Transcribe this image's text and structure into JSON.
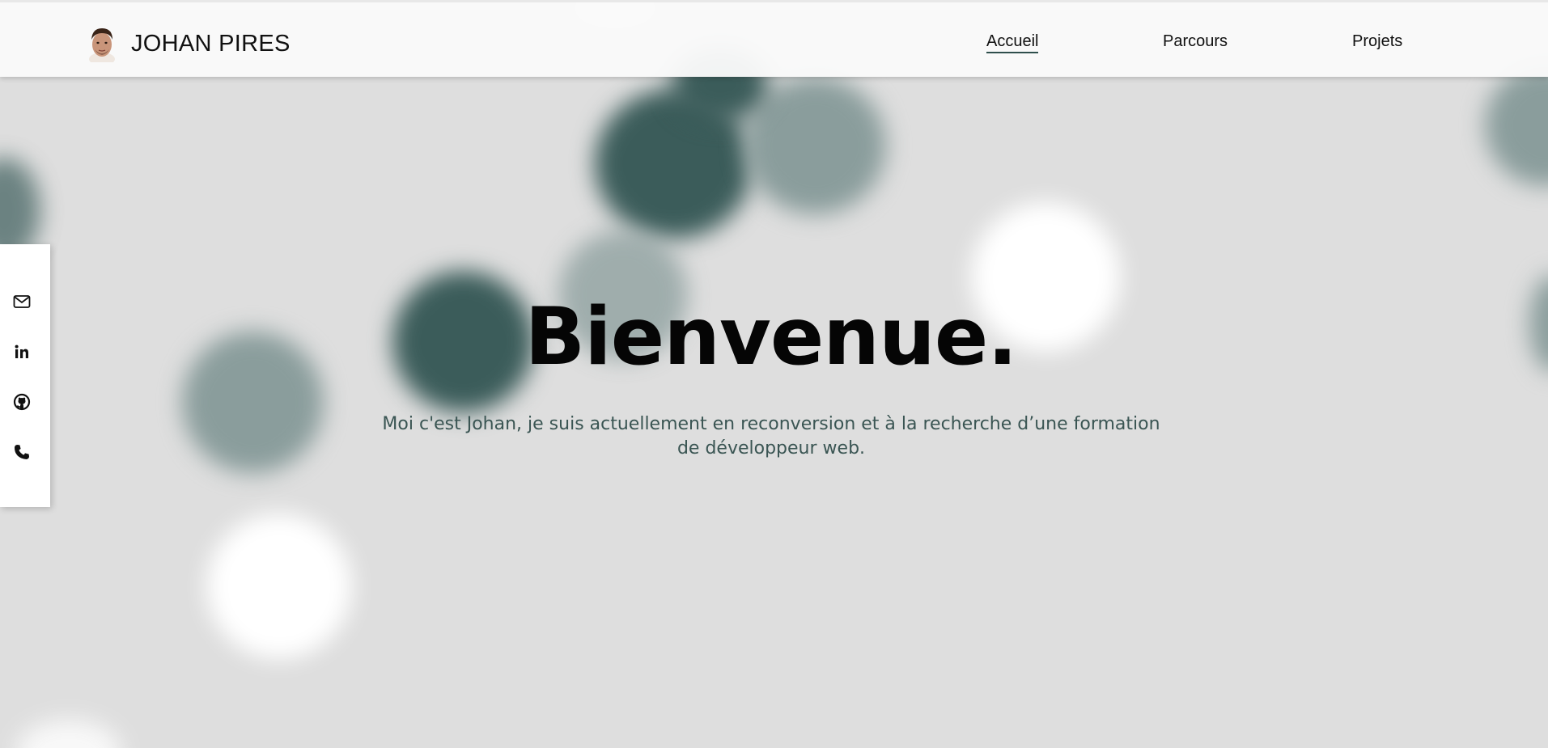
{
  "header": {
    "brand_name": "JOHAN PIRES",
    "avatar_icon": "avatar-photo",
    "nav": [
      {
        "label": "Accueil",
        "active": true
      },
      {
        "label": "Parcours",
        "active": false
      },
      {
        "label": "Projets",
        "active": false
      }
    ]
  },
  "social": {
    "items": [
      {
        "icon": "mail-icon"
      },
      {
        "icon": "linkedin-icon"
      },
      {
        "icon": "github-icon"
      },
      {
        "icon": "phone-icon"
      }
    ]
  },
  "hero": {
    "title": "Bienvenue.",
    "subtitle_line1": "Moi c'est Johan, je suis actuellement en reconversion et à la recherche d’une formation",
    "subtitle_line2": "de développeur web."
  },
  "colors": {
    "background": "#dedede",
    "accent_dark": "#3b5c5a",
    "accent_mid": "#8a9d9c",
    "subtitle": "#3a5553"
  }
}
